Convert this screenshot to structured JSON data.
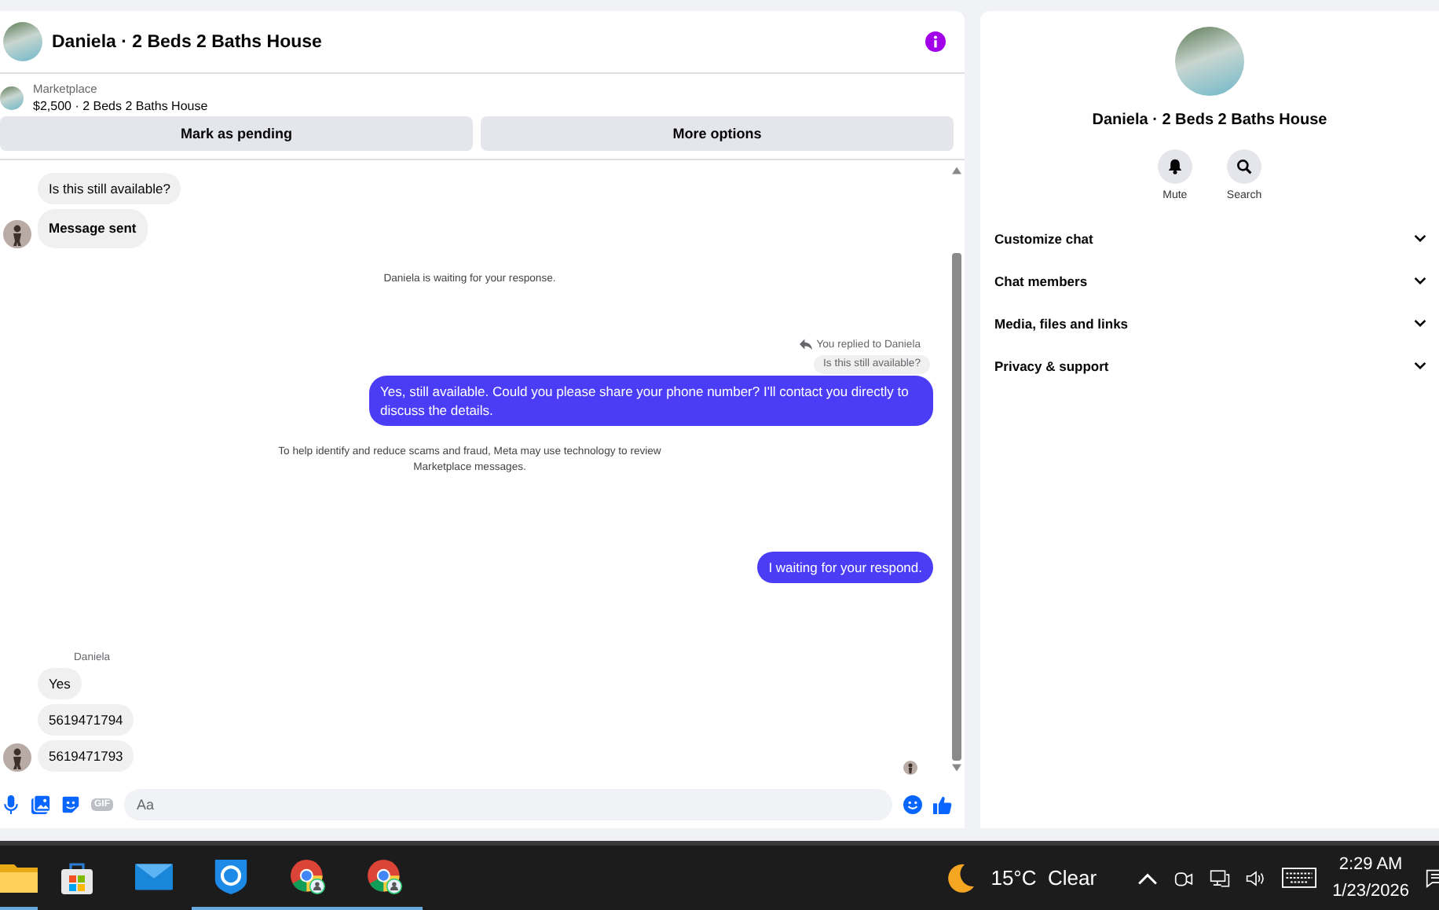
{
  "chat": {
    "title": "Daniela · 2 Beds 2 Baths House",
    "listing": {
      "source": "Marketplace",
      "summary": "$2,500 · 2 Beds 2 Baths House"
    },
    "actions": [
      "Mark as pending",
      "More options"
    ],
    "messages": [
      {
        "kind": "incoming",
        "text": "Is this still available?",
        "bold": false,
        "avatar": false
      },
      {
        "kind": "incoming",
        "text": "Message sent",
        "bold": true,
        "avatar": true
      },
      {
        "kind": "notice",
        "text": "Daniela is waiting for your response."
      },
      {
        "kind": "reply-label",
        "text": "You replied to Daniela"
      },
      {
        "kind": "quoted",
        "text": "Is this still available?"
      },
      {
        "kind": "outgoing",
        "text": "Yes, still available. Could you please share your phone number? I'll contact you directly to discuss the details."
      },
      {
        "kind": "notice",
        "text": "To help identify and reduce scams and fraud, Meta may use technology to review Marketplace messages."
      },
      {
        "kind": "outgoing",
        "text": "I waiting for your respond."
      },
      {
        "kind": "sender",
        "text": "Daniela"
      },
      {
        "kind": "incoming",
        "text": "Yes",
        "bold": false,
        "avatar": false
      },
      {
        "kind": "incoming",
        "text": "5619471794",
        "bold": false,
        "avatar": false
      },
      {
        "kind": "incoming",
        "text": "5619471793",
        "bold": false,
        "avatar": true
      }
    ],
    "composer": {
      "placeholder": "Aa",
      "gif_label": "GIF"
    }
  },
  "details": {
    "title": "Daniela · 2 Beds 2 Baths House",
    "actions": [
      {
        "kind": "mute",
        "label": "Mute"
      },
      {
        "kind": "search",
        "label": "Search"
      }
    ],
    "sections": [
      {
        "label": "Customize chat",
        "expanded": false
      },
      {
        "label": "Chat members",
        "expanded": false
      },
      {
        "label": "Media, files and links",
        "expanded": false
      },
      {
        "label": "Privacy & support",
        "expanded": false
      }
    ]
  },
  "taskbar": {
    "apps": [
      {
        "kind": "folder",
        "running": true
      },
      {
        "kind": "store",
        "running": false
      },
      {
        "kind": "mail",
        "running": false
      },
      {
        "kind": "shield",
        "running": true
      },
      {
        "kind": "browser",
        "running": true
      },
      {
        "kind": "browser",
        "running": true
      }
    ],
    "weather": "15°C  Clear",
    "time": "2:29 AM",
    "date": "1/23/2026"
  }
}
